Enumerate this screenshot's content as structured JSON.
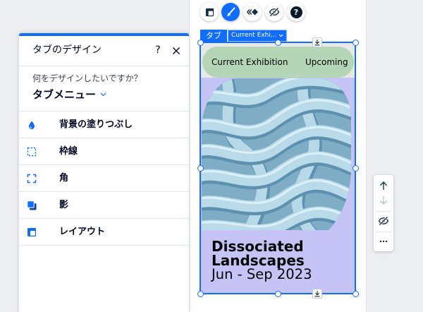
{
  "panel": {
    "title": "タブのデザイン",
    "help_label": "?",
    "help_icon": "question-icon",
    "close_icon": "close-icon",
    "question": "何をデザインしたいですか？",
    "selected_part": "タブメニュー",
    "selected_part_icon": "chevron-down-icon",
    "options": [
      {
        "label": "背景の塗りつぶし",
        "icon": "fill-drop-icon"
      },
      {
        "label": "枠線",
        "icon": "border-icon"
      },
      {
        "label": "角",
        "icon": "corners-icon"
      },
      {
        "label": "影",
        "icon": "shadow-icon"
      },
      {
        "label": "レイアウト",
        "icon": "layout-icon"
      }
    ]
  },
  "floating_toolbar": {
    "buttons": [
      {
        "icon": "layout-icon",
        "active": false
      },
      {
        "icon": "design-brush-icon",
        "active": true
      },
      {
        "icon": "animation-icon",
        "active": false
      },
      {
        "icon": "hide-eye-icon",
        "active": false
      },
      {
        "icon": "help-icon",
        "active": false,
        "label": "?"
      }
    ]
  },
  "element_tag": {
    "type_label": "タブ",
    "current_tab": "Current Exhi...",
    "dropdown_icon": "chevron-down-icon"
  },
  "tab_menu": {
    "tabs": [
      "Current Exhibition",
      "Upcoming"
    ]
  },
  "tab_content": {
    "title_lines": [
      "Dissociated",
      "Landscapes"
    ],
    "dates": "Jun - Sep 2023"
  },
  "arrange_toolbar": {
    "buttons": [
      {
        "icon": "move-forward-icon",
        "enabled": true
      },
      {
        "icon": "move-backward-icon",
        "enabled": false
      },
      {
        "icon": "hide-eye-icon",
        "enabled": true
      },
      {
        "icon": "more-icon",
        "enabled": true
      }
    ]
  },
  "colors": {
    "accent": "#116dff",
    "tab_menu_bg": "#b4d6b6",
    "content_bg": "#c6c3f6",
    "text_dark": "#000624"
  }
}
